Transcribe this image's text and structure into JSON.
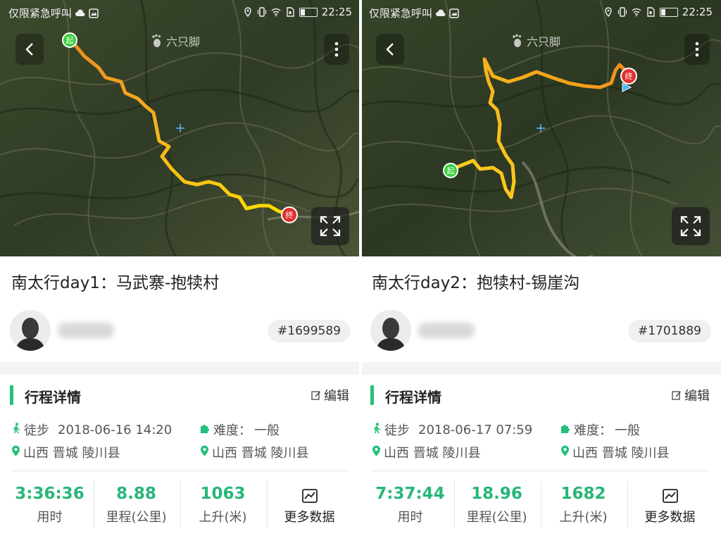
{
  "status_bar": {
    "carrier": "仅限紧急呼叫",
    "time": "22:25"
  },
  "logo_text": "六只脚",
  "colors": {
    "accent": "#27c07a",
    "stat_value": "#27b779",
    "track_start": "#f08b1d",
    "track_end": "#ffe000",
    "start_marker": "#36d03a",
    "end_marker": "#e03030"
  },
  "panels": [
    {
      "title": "南太行day1：马武寨-抱犊村",
      "trip_id": "#1699589",
      "section_title": "行程详情",
      "edit_label": "编辑",
      "activity": "徒步",
      "datetime": "2018-06-16  14:20",
      "difficulty_label": "难度：",
      "difficulty": "一般",
      "start_location": "山西   晋城   陵川县",
      "end_location": "山西   晋城   陵川县",
      "start_marker_label": "起",
      "end_marker_label": "终",
      "stats": [
        {
          "value": "3:36:36",
          "label": "用时"
        },
        {
          "value": "8.88",
          "label": "里程(公里)"
        },
        {
          "value": "1063",
          "label": "上升(米)"
        }
      ],
      "more_label": "更多数据"
    },
    {
      "title": "南太行day2：抱犊村-锡崖沟",
      "trip_id": "#1701889",
      "section_title": "行程详情",
      "edit_label": "编辑",
      "activity": "徒步",
      "datetime": "2018-06-17  07:59",
      "difficulty_label": "难度：",
      "difficulty": "一般",
      "start_location": "山西   晋城   陵川县",
      "end_location": "山西   晋城   陵川县",
      "start_marker_label": "起",
      "end_marker_label": "终",
      "stats": [
        {
          "value": "7:37:44",
          "label": "用时"
        },
        {
          "value": "18.96",
          "label": "里程(公里)"
        },
        {
          "value": "1682",
          "label": "上升(米)"
        }
      ],
      "more_label": "更多数据"
    }
  ]
}
